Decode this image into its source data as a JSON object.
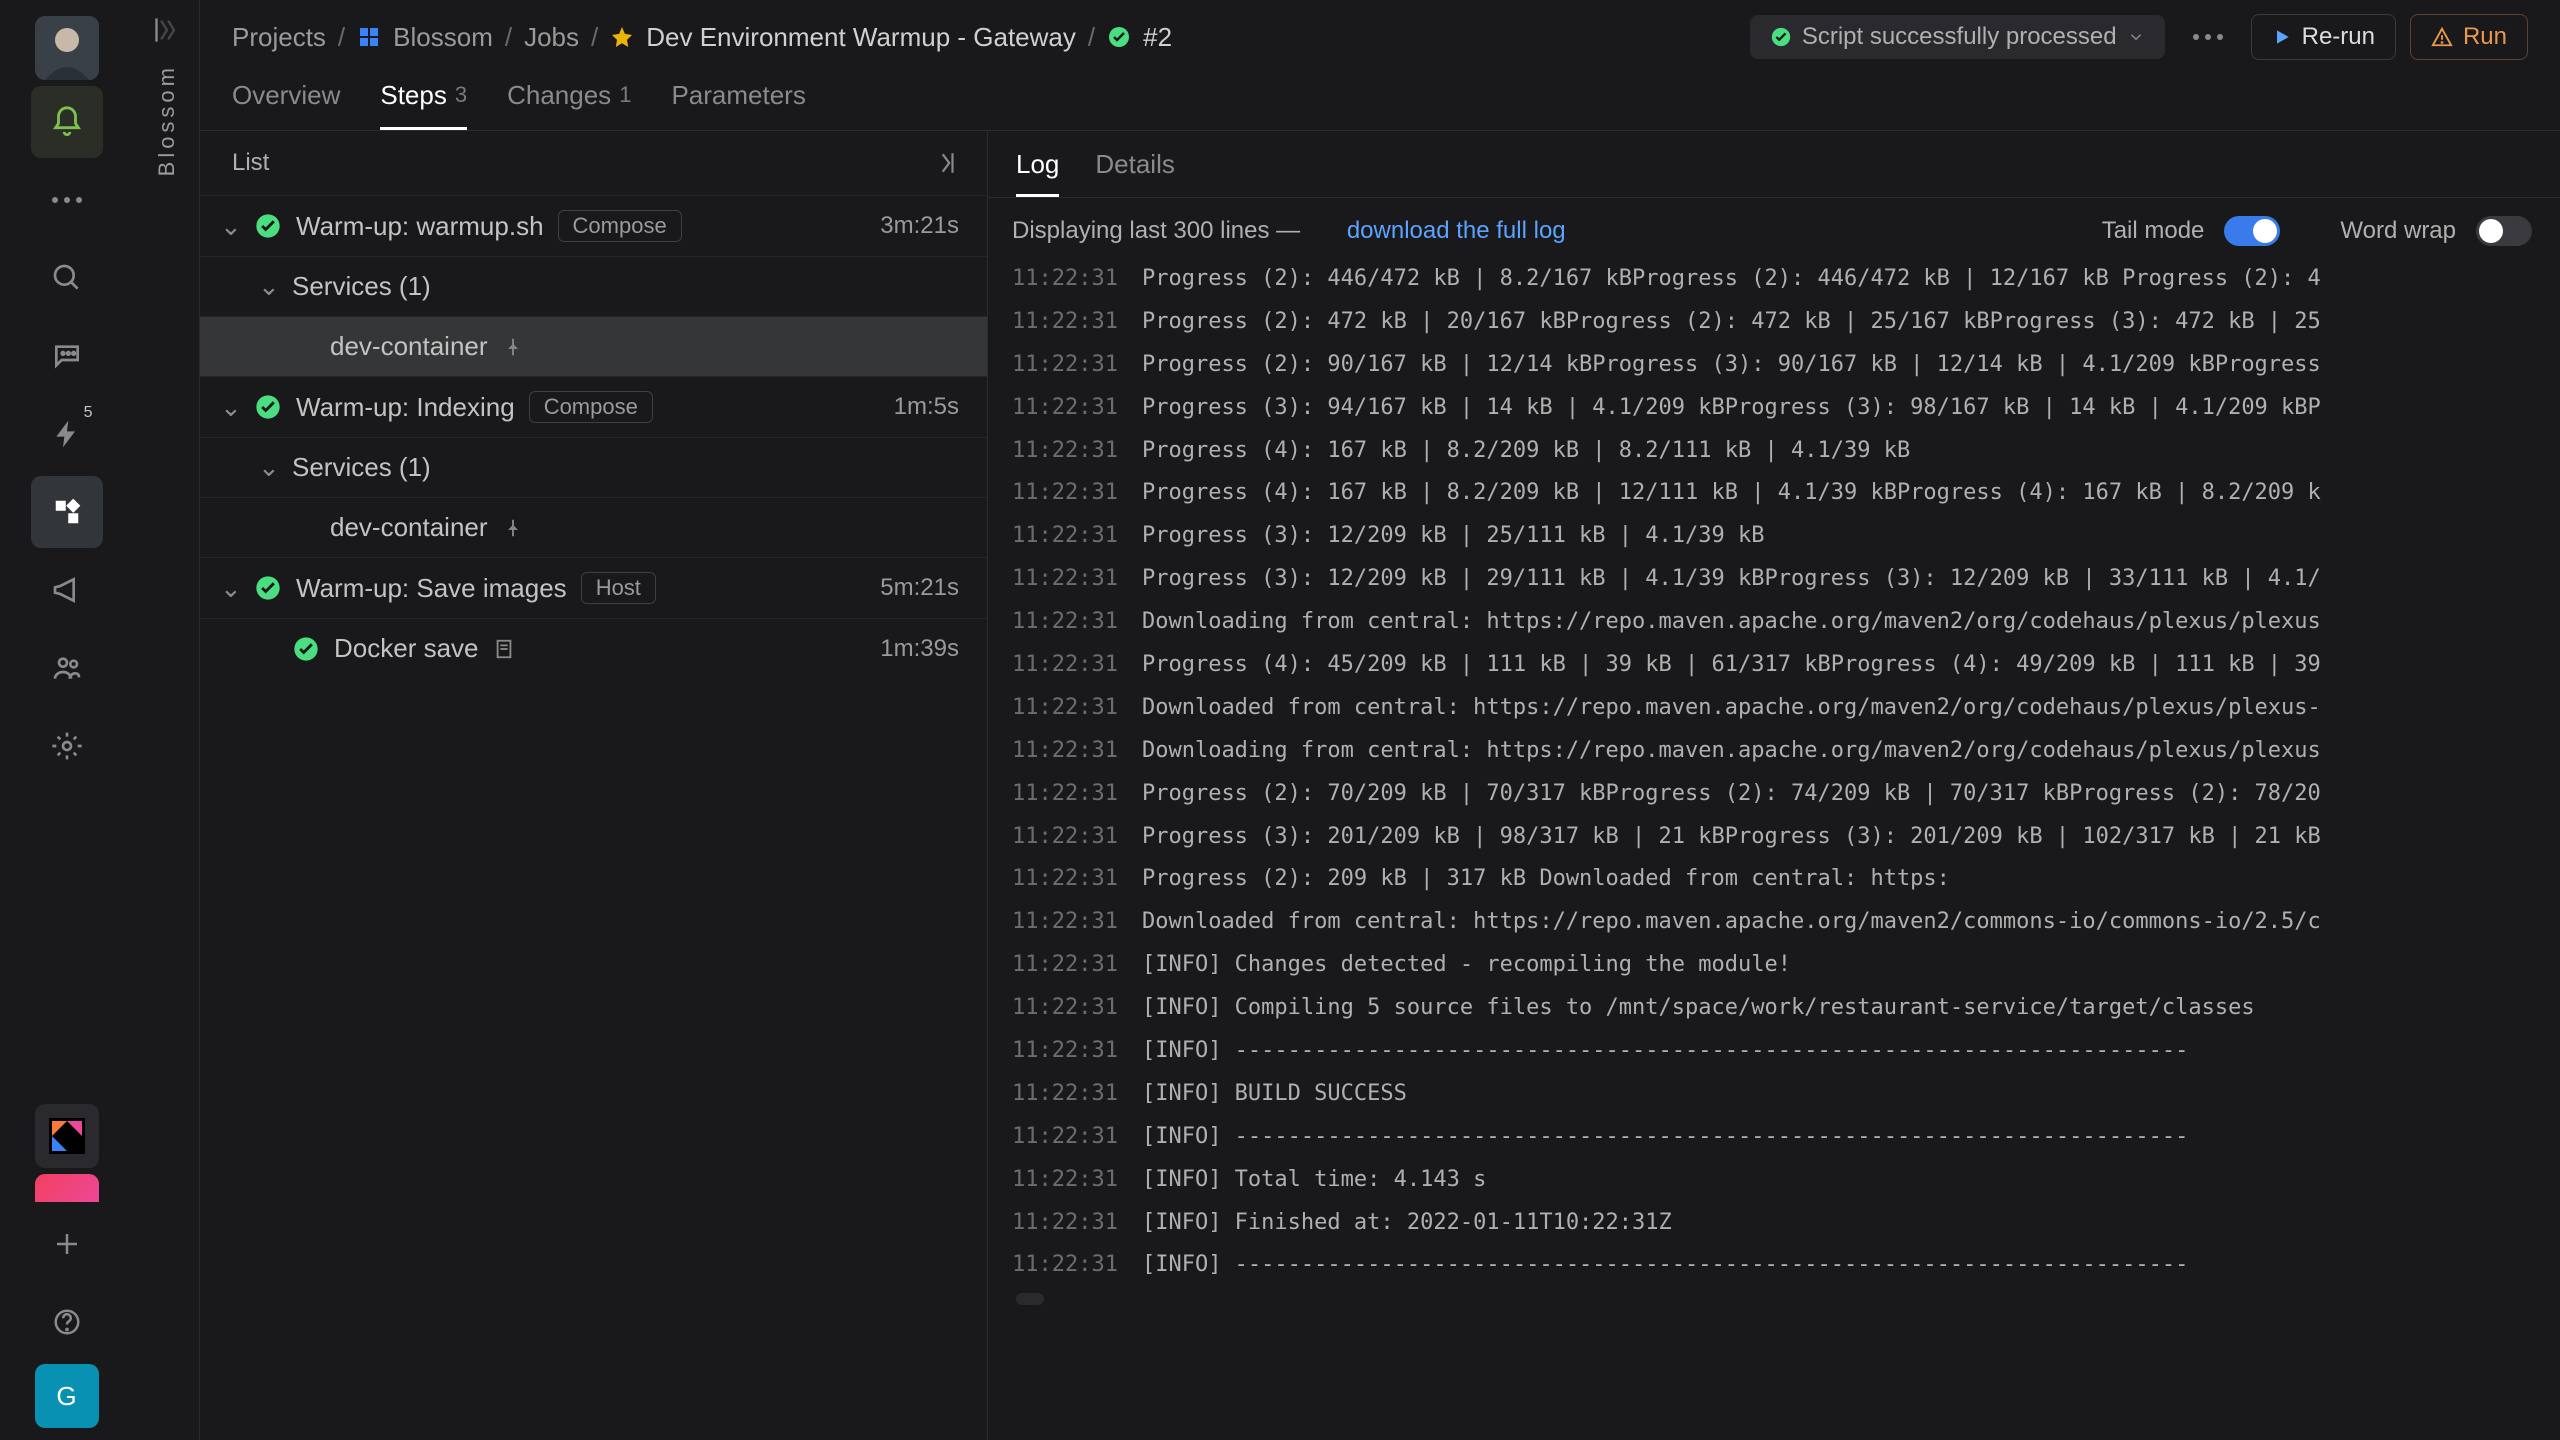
{
  "project_name": "Blossom",
  "breadcrumb": {
    "projects": "Projects",
    "project": "Blossom",
    "jobs": "Jobs",
    "job": "Dev Environment Warmup - Gateway",
    "run": "#2"
  },
  "status_pill": "Script successfully processed",
  "buttons": {
    "rerun": "Re-run",
    "run": "Run"
  },
  "sidebar_badge": "5",
  "tabs": {
    "overview": "Overview",
    "steps": "Steps",
    "steps_count": "3",
    "changes": "Changes",
    "changes_count": "1",
    "parameters": "Parameters"
  },
  "steps_panel": {
    "header": "List",
    "items": [
      {
        "title": "Warm-up: warmup.sh",
        "badge": "Compose",
        "duration": "3m:21s",
        "level": 0,
        "status": true,
        "caret": true
      },
      {
        "title": "Services (1)",
        "level": 1,
        "caret": true
      },
      {
        "title": "dev-container",
        "level": 2,
        "selected": true,
        "pin": true
      },
      {
        "title": "Warm-up: Indexing",
        "badge": "Compose",
        "duration": "1m:5s",
        "level": 0,
        "status": true,
        "caret": true
      },
      {
        "title": "Services (1)",
        "level": 1,
        "caret": true
      },
      {
        "title": "dev-container",
        "level": 2,
        "pin": true
      },
      {
        "title": "Warm-up: Save images",
        "badge": "Host",
        "duration": "5m:21s",
        "level": 0,
        "status": true,
        "caret": true
      },
      {
        "title": "Docker save",
        "level": 1,
        "status": true,
        "duration": "1m:39s",
        "doc": true
      }
    ]
  },
  "log_panel": {
    "tabs": {
      "log": "Log",
      "details": "Details"
    },
    "info_prefix": "Displaying last 300 lines —",
    "download_link": "download the full log",
    "tail_label": "Tail mode",
    "wrap_label": "Word wrap",
    "timestamp": "11:22:31",
    "lines": [
      "Progress (2): 446/472 kB | 8.2/167 kBProgress (2): 446/472 kB | 12/167 kB Progress (2): 4",
      "Progress (2): 472 kB | 20/167 kBProgress (2): 472 kB | 25/167 kBProgress (3): 472 kB | 25",
      "Progress (2): 90/167 kB | 12/14 kBProgress (3): 90/167 kB | 12/14 kB | 4.1/209 kBProgress",
      "Progress (3): 94/167 kB | 14 kB | 4.1/209 kBProgress (3): 98/167 kB | 14 kB | 4.1/209 kBP",
      "Progress (4): 167 kB | 8.2/209 kB | 8.2/111 kB | 4.1/39 kB",
      "Progress (4): 167 kB | 8.2/209 kB | 12/111 kB | 4.1/39 kBProgress (4): 167 kB | 8.2/209 k",
      "Progress (3): 12/209 kB | 25/111 kB | 4.1/39 kB",
      "Progress (3): 12/209 kB | 29/111 kB | 4.1/39 kBProgress (3): 12/209 kB | 33/111 kB | 4.1/",
      "Downloading from central: https://repo.maven.apache.org/maven2/org/codehaus/plexus/plexus",
      "Progress (4): 45/209 kB | 111 kB | 39 kB | 61/317 kBProgress (4): 49/209 kB | 111 kB | 39",
      "Downloaded from central: https://repo.maven.apache.org/maven2/org/codehaus/plexus/plexus-",
      "Downloading from central: https://repo.maven.apache.org/maven2/org/codehaus/plexus/plexus",
      "Progress (2): 70/209 kB | 70/317 kBProgress (2): 74/209 kB | 70/317 kBProgress (2): 78/20",
      "Progress (3): 201/209 kB | 98/317 kB | 21 kBProgress (3): 201/209 kB | 102/317 kB | 21 kB",
      "Progress (2): 209 kB | 317 kB                                        Downloaded from central: https:",
      "Downloaded from central: https://repo.maven.apache.org/maven2/commons-io/commons-io/2.5/c",
      "[INFO] Changes detected - recompiling the module!",
      "[INFO] Compiling 5 source files to /mnt/space/work/restaurant-service/target/classes",
      "[INFO] ------------------------------------------------------------------------",
      "[INFO] BUILD SUCCESS",
      "[INFO] ------------------------------------------------------------------------",
      "[INFO] Total time:  4.143 s",
      "[INFO] Finished at: 2022-01-11T10:22:31Z",
      "[INFO] ------------------------------------------------------------------------"
    ]
  }
}
